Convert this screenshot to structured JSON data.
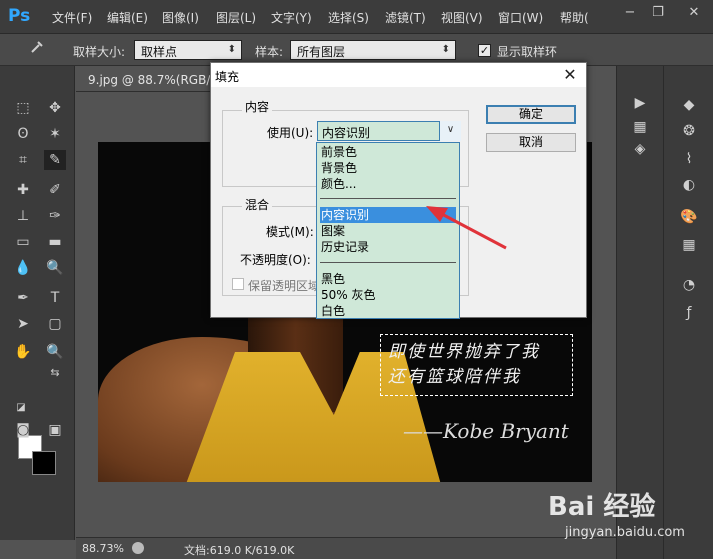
{
  "app": {
    "logo": "Ps"
  },
  "menu": [
    "文件(F)",
    "编辑(E)",
    "图像(I)",
    "图层(L)",
    "文字(Y)",
    "选择(S)",
    "滤镜(T)",
    "视图(V)",
    "窗口(W)",
    "帮助("
  ],
  "window_controls": {
    "minimize": "−",
    "restore": "❐",
    "close": "✕"
  },
  "options": {
    "sample_size_label": "取样大小:",
    "sample_size_value": "取样点",
    "sample_label": "样本:",
    "sample_value": "所有图层",
    "show_ring_label": "显示取样环",
    "show_ring_checked": true
  },
  "document": {
    "tab_label": "9.jpg @ 88.7%(RGB/8#",
    "calligraphy_line1": "即使世界抛弃了我",
    "calligraphy_line2": "还有篮球陪伴我",
    "signature": "——Kobe Bryant"
  },
  "status": {
    "zoom": "88.73%",
    "doc_info": "文档:619.0 K/619.0K"
  },
  "dialog": {
    "title": "填充",
    "content_group": "内容",
    "use_label": "使用(U):",
    "use_value": "内容识别",
    "blend_group": "混合",
    "mode_label": "模式(M):",
    "opacity_label": "不透明度(O):",
    "preserve_label": "保留透明区域",
    "ok_label": "确定",
    "cancel_label": "取消"
  },
  "dropdown": {
    "items": [
      "前景色",
      "背景色",
      "颜色...",
      "内容识别",
      "图案",
      "历史记录",
      "黑色",
      "50% 灰色",
      "白色"
    ],
    "selected": "内容识别"
  },
  "watermark": {
    "logo": "Bai 经验",
    "url": "jingyan.baidu.com"
  },
  "colors": {
    "foreground": "#ffffff",
    "background": "#000000",
    "highlight": "#3a8fde",
    "dropdown_bg": "#cfe8d8",
    "arrow": "#e0333a"
  },
  "icons": {
    "tools": [
      "marquee-icon",
      "move-icon",
      "lasso-icon",
      "magic-wand-icon",
      "crop-icon",
      "eyedropper-icon",
      "healing-brush-icon",
      "brush-icon",
      "clone-stamp-icon",
      "history-brush-icon",
      "eraser-icon",
      "gradient-icon",
      "blur-icon",
      "dodge-icon",
      "pen-icon",
      "type-icon",
      "path-selection-icon",
      "shape-icon",
      "hand-icon",
      "zoom-icon"
    ]
  }
}
